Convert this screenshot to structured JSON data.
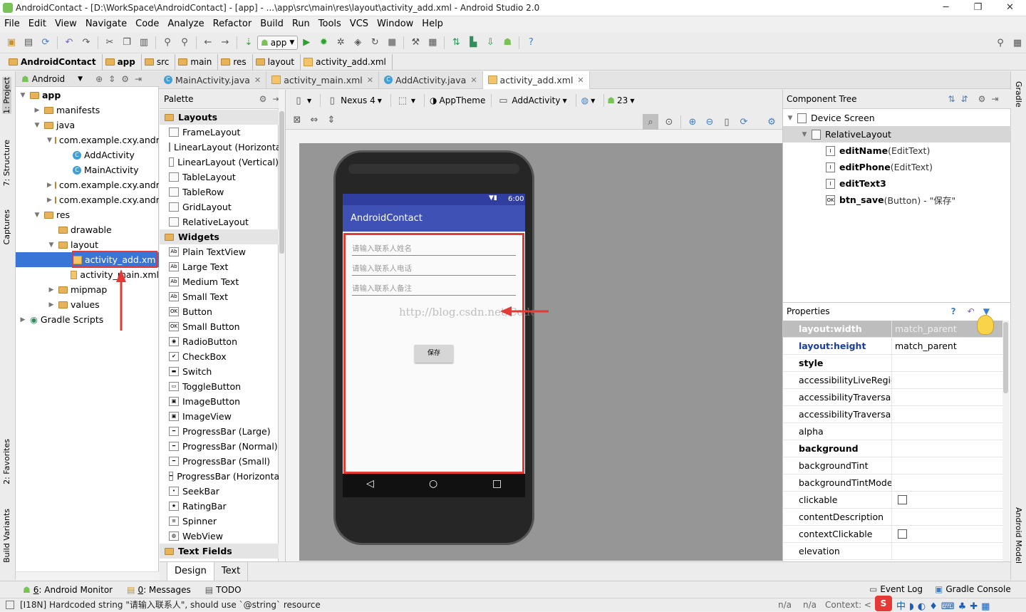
{
  "window": {
    "title": "AndroidContact - [D:\\WorkSpace\\AndroidContact] - [app] - ...\\app\\src\\main\\res\\layout\\activity_add.xml - Android Studio 2.0",
    "min": "─",
    "max": "❐",
    "close": "✕"
  },
  "menu": [
    "File",
    "Edit",
    "View",
    "Navigate",
    "Code",
    "Analyze",
    "Refactor",
    "Build",
    "Run",
    "Tools",
    "VCS",
    "Window",
    "Help"
  ],
  "toolbar": {
    "run_config": "app"
  },
  "breadcrumb": [
    "AndroidContact",
    "app",
    "src",
    "main",
    "res",
    "layout",
    "activity_add.xml"
  ],
  "side_tabs_left": [
    "1: Project",
    "7: Structure",
    "Captures",
    "2: Favorites",
    "Build Variants"
  ],
  "side_tabs_right": [
    "Gradle",
    "Android Model"
  ],
  "project": {
    "view": "Android",
    "tree": [
      {
        "label": "app",
        "indent": 0,
        "arrow": "▼",
        "icon": "folder",
        "bold": true
      },
      {
        "label": "manifests",
        "indent": 1,
        "arrow": "▶",
        "icon": "folder"
      },
      {
        "label": "java",
        "indent": 1,
        "arrow": "▼",
        "icon": "folder"
      },
      {
        "label": "com.example.cxy.androidcontact",
        "indent": 2,
        "arrow": "▼",
        "icon": "folder"
      },
      {
        "label": "AddActivity",
        "indent": 3,
        "arrow": "",
        "icon": "class"
      },
      {
        "label": "MainActivity",
        "indent": 3,
        "arrow": "",
        "icon": "class"
      },
      {
        "label": "com.example.cxy.androidcontact",
        "indent": 2,
        "arrow": "▶",
        "icon": "folder"
      },
      {
        "label": "com.example.cxy.androidcontact",
        "indent": 2,
        "arrow": "▶",
        "icon": "folder"
      },
      {
        "label": "res",
        "indent": 1,
        "arrow": "▼",
        "icon": "folder"
      },
      {
        "label": "drawable",
        "indent": 2,
        "arrow": "",
        "icon": "folder"
      },
      {
        "label": "layout",
        "indent": 2,
        "arrow": "▼",
        "icon": "folder"
      },
      {
        "label": "activity_add.xml",
        "indent": 3,
        "arrow": "",
        "icon": "xml",
        "selected": true
      },
      {
        "label": "activity_main.xml",
        "indent": 3,
        "arrow": "",
        "icon": "xml"
      },
      {
        "label": "mipmap",
        "indent": 2,
        "arrow": "▶",
        "icon": "folder"
      },
      {
        "label": "values",
        "indent": 2,
        "arrow": "▶",
        "icon": "folder"
      },
      {
        "label": "Gradle Scripts",
        "indent": 0,
        "arrow": "▶",
        "icon": "gradle"
      }
    ]
  },
  "editor_tabs": [
    {
      "label": "MainActivity.java",
      "icon": "class",
      "active": false
    },
    {
      "label": "activity_main.xml",
      "icon": "xml",
      "active": false
    },
    {
      "label": "AddActivity.java",
      "icon": "class",
      "active": false
    },
    {
      "label": "activity_add.xml",
      "icon": "xml",
      "active": true
    }
  ],
  "palette": {
    "title": "Palette",
    "items": [
      {
        "label": "Layouts",
        "cat": true
      },
      {
        "label": "FrameLayout",
        "glyph": ""
      },
      {
        "label": "LinearLayout (Horizontal)",
        "glyph": ""
      },
      {
        "label": "LinearLayout (Vertical)",
        "glyph": ""
      },
      {
        "label": "TableLayout",
        "glyph": ""
      },
      {
        "label": "TableRow",
        "glyph": ""
      },
      {
        "label": "GridLayout",
        "glyph": ""
      },
      {
        "label": "RelativeLayout",
        "glyph": ""
      },
      {
        "label": "Widgets",
        "cat": true
      },
      {
        "label": "Plain TextView",
        "glyph": "Ab"
      },
      {
        "label": "Large Text",
        "glyph": "Ab"
      },
      {
        "label": "Medium Text",
        "glyph": "Ab"
      },
      {
        "label": "Small Text",
        "glyph": "Ab"
      },
      {
        "label": "Button",
        "glyph": "OK"
      },
      {
        "label": "Small Button",
        "glyph": "OK"
      },
      {
        "label": "RadioButton",
        "glyph": "◉"
      },
      {
        "label": "CheckBox",
        "glyph": "✔"
      },
      {
        "label": "Switch",
        "glyph": "▬"
      },
      {
        "label": "ToggleButton",
        "glyph": "▭"
      },
      {
        "label": "ImageButton",
        "glyph": "▣"
      },
      {
        "label": "ImageView",
        "glyph": "▣"
      },
      {
        "label": "ProgressBar (Large)",
        "glyph": "━"
      },
      {
        "label": "ProgressBar (Normal)",
        "glyph": "━"
      },
      {
        "label": "ProgressBar (Small)",
        "glyph": "━"
      },
      {
        "label": "ProgressBar (Horizontal)",
        "glyph": "━"
      },
      {
        "label": "SeekBar",
        "glyph": "•"
      },
      {
        "label": "RatingBar",
        "glyph": "★"
      },
      {
        "label": "Spinner",
        "glyph": "≡"
      },
      {
        "label": "WebView",
        "glyph": "◍"
      },
      {
        "label": "Text Fields",
        "cat": true
      }
    ]
  },
  "design_toolbar": {
    "device": "Nexus 4",
    "theme": "AppTheme",
    "activity": "AddActivity",
    "api": "23"
  },
  "device": {
    "time": "6:00",
    "app_title": "AndroidContact",
    "fields": [
      "请输入联系人姓名",
      "请输入联系人电话",
      "请输入联系人备注"
    ],
    "button": "保存",
    "watermark": "http://blog.csdn.net/CodeFarmerCXY",
    "nav": [
      "◁",
      "○",
      "□"
    ]
  },
  "component_tree": {
    "title": "Component Tree",
    "items": [
      {
        "label": "Device Screen",
        "indent": 0,
        "arrow": "▼"
      },
      {
        "label": "RelativeLayout",
        "indent": 1,
        "arrow": "▼",
        "selected": true
      },
      {
        "label": "editName",
        "type": " (EditText)",
        "indent": 2
      },
      {
        "label": "editPhone",
        "type": " (EditText)",
        "indent": 2
      },
      {
        "label": "editText3",
        "type": "",
        "indent": 2
      },
      {
        "label": "btn_save",
        "type": " (Button) - \"保存\"",
        "indent": 2
      }
    ]
  },
  "properties": {
    "title": "Properties",
    "rows": [
      {
        "name": "layout:width",
        "value": "match_parent",
        "style": "selected"
      },
      {
        "name": "layout:height",
        "value": "match_parent",
        "style": "blue"
      },
      {
        "name": "style",
        "value": "",
        "style": "bold"
      },
      {
        "name": "accessibilityLiveRegion",
        "value": ""
      },
      {
        "name": "accessibilityTraversalAfter",
        "value": ""
      },
      {
        "name": "accessibilityTraversalBefore",
        "value": ""
      },
      {
        "name": "alpha",
        "value": ""
      },
      {
        "name": "background",
        "value": "",
        "style": "bold"
      },
      {
        "name": "backgroundTint",
        "value": ""
      },
      {
        "name": "backgroundTintMode",
        "value": ""
      },
      {
        "name": "clickable",
        "value": "",
        "check": true
      },
      {
        "name": "contentDescription",
        "value": ""
      },
      {
        "name": "contextClickable",
        "value": "",
        "check": true
      },
      {
        "name": "elevation",
        "value": ""
      }
    ]
  },
  "design_tabs": [
    "Design",
    "Text"
  ],
  "tool_windows": {
    "left": [
      {
        "num": "6",
        "label": ": Android Monitor"
      },
      {
        "num": "0",
        "label": ": Messages"
      },
      {
        "num": "",
        "label": "TODO"
      }
    ],
    "right": [
      "Event Log",
      "Gradle Console"
    ]
  },
  "status": {
    "message": "[I18N] Hardcoded string \"请输入联系人\", should use `@string` resource",
    "na1": "n/a",
    "na2": "n/a",
    "context": "Context: <no context>"
  }
}
